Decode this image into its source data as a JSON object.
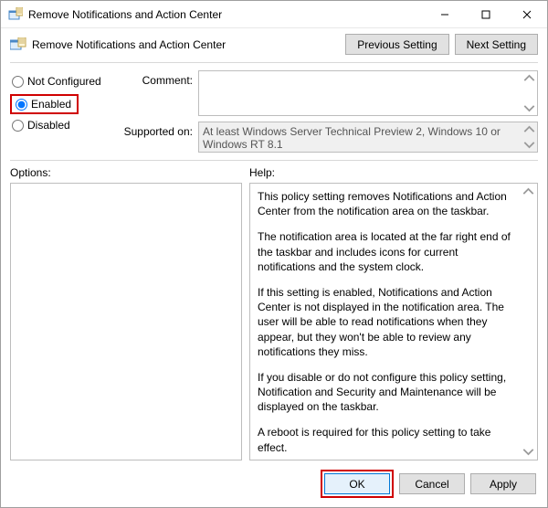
{
  "titlebar": {
    "title": "Remove Notifications and Action Center"
  },
  "header": {
    "title": "Remove Notifications and Action Center",
    "prev_btn": "Previous Setting",
    "next_btn": "Next Setting"
  },
  "radios": {
    "not_configured": "Not Configured",
    "enabled": "Enabled",
    "disabled": "Disabled",
    "selected": "enabled"
  },
  "fields": {
    "comment_label": "Comment:",
    "comment_value": "",
    "supported_label": "Supported on:",
    "supported_value": "At least Windows Server Technical Preview 2, Windows 10 or Windows RT 8.1"
  },
  "labels": {
    "options": "Options:",
    "help": "Help:"
  },
  "help_paragraphs": [
    "This policy setting removes Notifications and Action Center from the notification area on the taskbar.",
    "The notification area is located at the far right end of the taskbar and includes icons for current notifications and the system clock.",
    "If this setting is enabled, Notifications and Action Center is not displayed in the notification area. The user will be able to read notifications when they appear, but they won't be able to review any notifications they miss.",
    "If you disable or do not configure this policy setting, Notification and Security and Maintenance will be displayed on the taskbar.",
    "A reboot is required for this policy setting to take effect."
  ],
  "footer": {
    "ok": "OK",
    "cancel": "Cancel",
    "apply": "Apply"
  }
}
